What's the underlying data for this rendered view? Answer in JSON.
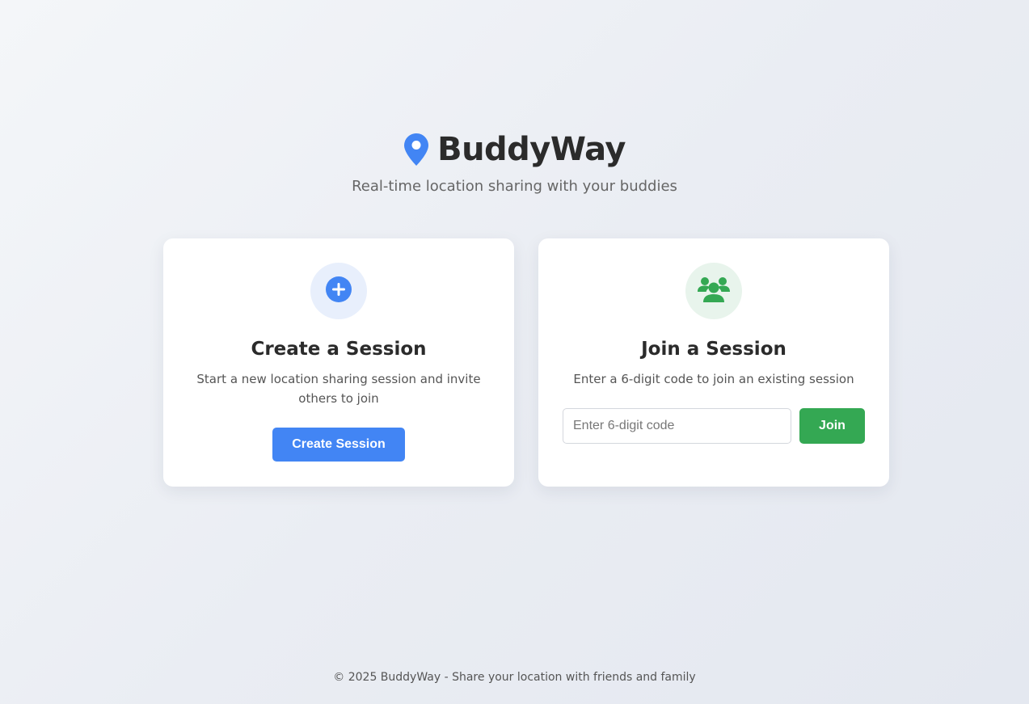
{
  "app": {
    "title": "BuddyWay",
    "tagline": "Real-time location sharing with your buddies",
    "brand_color": "#4285f4",
    "logo_icon": "map-pin-icon"
  },
  "create_card": {
    "icon": "plus-circle-icon",
    "title": "Create a Session",
    "description": "Start a new location sharing session and invite others to join",
    "button_label": "Create Session",
    "accent": "#4285f4"
  },
  "join_card": {
    "icon": "users-icon",
    "title": "Join a Session",
    "description": "Enter a 6-digit code to join an existing session",
    "input_value": "",
    "input_placeholder": "Enter 6-digit code",
    "button_label": "Join",
    "accent": "#34a853"
  },
  "footer": {
    "text": "© 2025 BuddyWay - Share your location with friends and family"
  }
}
